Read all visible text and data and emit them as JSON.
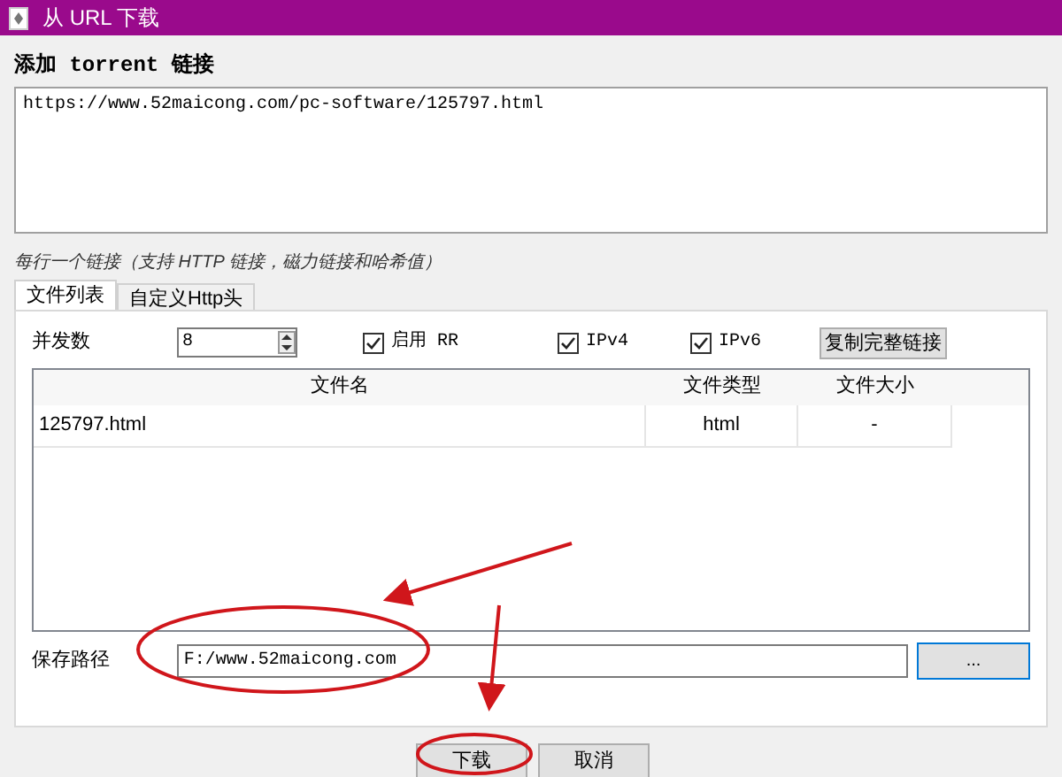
{
  "window": {
    "title": "从 URL 下载"
  },
  "links": {
    "label": "添加 torrent 链接",
    "value": "https://www.52maicong.com/pc-software/125797.html",
    "hint": "每行一个链接（支持 HTTP 链接，磁力链接和哈希值）"
  },
  "tabs": [
    {
      "label": "文件列表",
      "selected": true
    },
    {
      "label": "自定义Http头",
      "selected": false
    }
  ],
  "options": {
    "concurrency_label": "并发数",
    "concurrency": "8",
    "checkboxes": [
      {
        "label": "启用 RR",
        "checked": true
      },
      {
        "label": "IPv4",
        "checked": true
      },
      {
        "label": "IPv6",
        "checked": true
      }
    ],
    "copy_button": "复制完整链接"
  },
  "table": {
    "columns": [
      "文件名",
      "文件类型",
      "文件大小"
    ],
    "rows": [
      [
        "125797.html",
        "html",
        "-"
      ]
    ]
  },
  "save_path": {
    "label": "保存路径",
    "value": "F:/www.52maicong.com",
    "browse": "..."
  },
  "buttons": [
    "下载",
    "取消"
  ]
}
